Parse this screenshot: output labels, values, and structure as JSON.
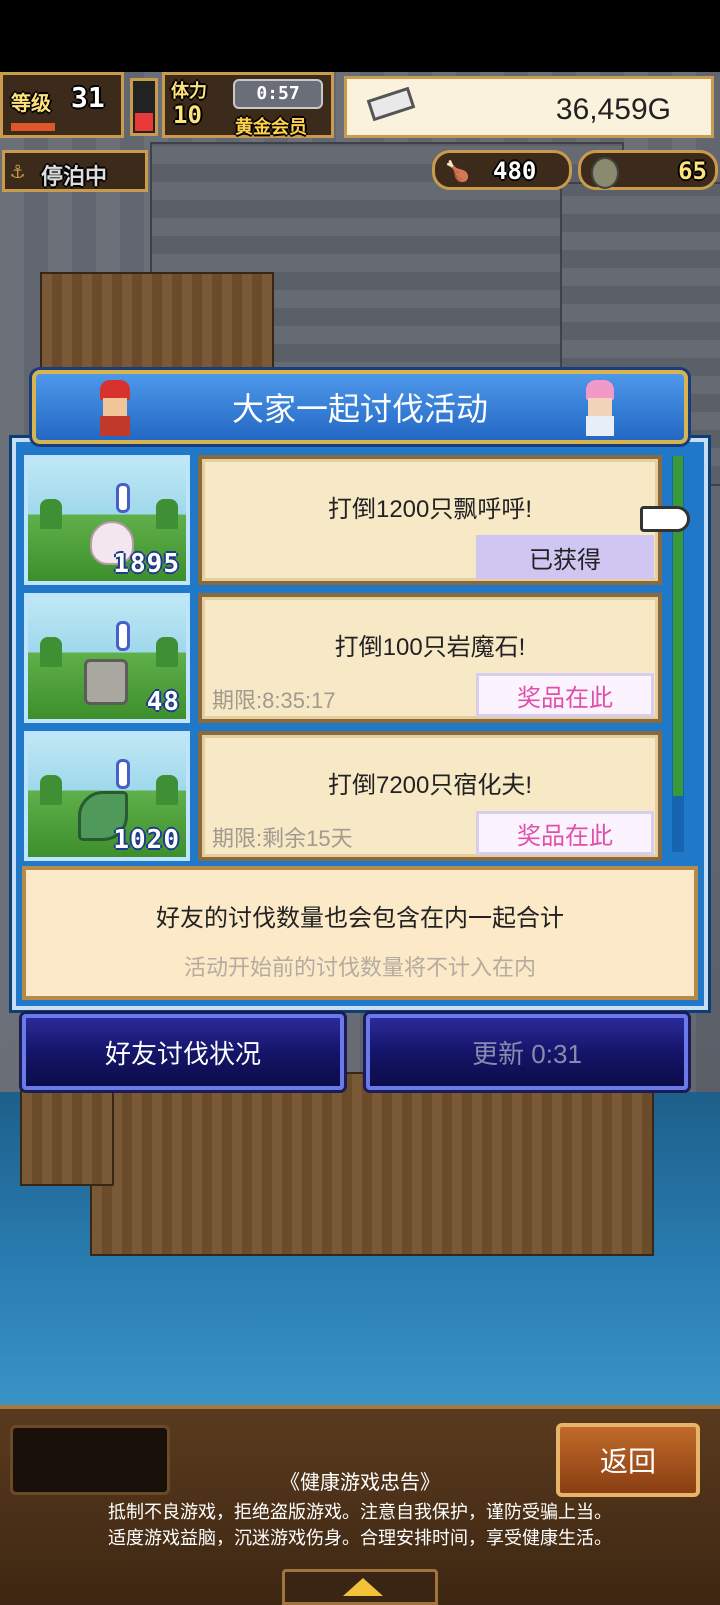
{
  "hud": {
    "level_label": "等级",
    "level": "31",
    "stamina_label": "体力",
    "stamina": "10",
    "timer": "0:57",
    "membership": "黄金会员",
    "gold": "36,459G",
    "docked": "停泊中",
    "food": "480",
    "medals": "65"
  },
  "dialog": {
    "title": "大家一起讨伐活动",
    "quests": [
      {
        "goal": "打倒1200只飘呼呼!",
        "count": "1895",
        "deadline": "",
        "button": "已获得"
      },
      {
        "goal": "打倒100只岩魔石!",
        "count": "48",
        "deadline": "期限:8:35:17",
        "button": "奖品在此"
      },
      {
        "goal": "打倒7200只宿化夫!",
        "count": "1020",
        "deadline": "期限:剩余15天",
        "button": "奖品在此"
      }
    ],
    "note_line1": "好友的讨伐数量也会包含在内一起合计",
    "note_line2": "活动开始前的讨伐数量将不计入在内",
    "friends_button": "好友讨伐状况",
    "refresh_button": "更新 0:31"
  },
  "bottom": {
    "back_button": "返回",
    "health_title": "《健康游戏忠告》",
    "health_line1": "抵制不良游戏，拒绝盗版游戏。注意自我保护，谨防受骗上当。",
    "health_line2": "适度游戏益脑，沉迷游戏伤身。合理安排时间，享受健康生活。"
  },
  "colors": {
    "dialog_blue": "#1f78c8",
    "card_bg": "#f7e8c6",
    "prize_pink": "#e04fa8",
    "got_lavender": "#cfc6f2"
  }
}
